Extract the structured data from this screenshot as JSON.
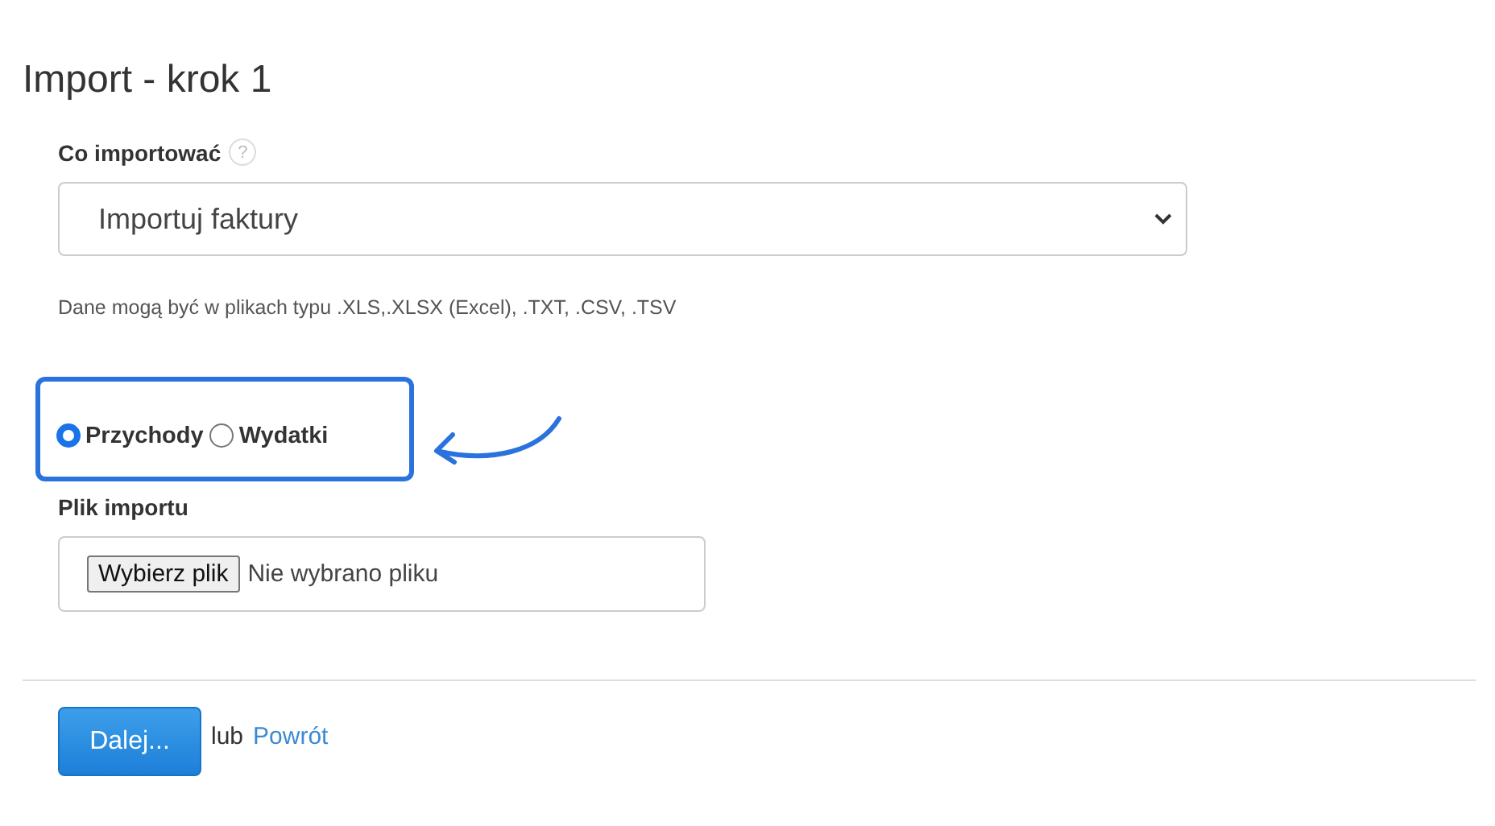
{
  "title": "Import - krok 1",
  "import_type": {
    "label": "Co importować",
    "help": "?",
    "value": "Importuj faktury"
  },
  "hint": "Dane mogą być w plikach typu .XLS,.XLSX (Excel), .TXT, .CSV, .TSV",
  "radios": [
    {
      "label": "Przychody",
      "selected": true
    },
    {
      "label": "Wydatki",
      "selected": false
    }
  ],
  "file": {
    "label": "Plik importu",
    "button": "Wybierz plik",
    "status": "Nie wybrano pliku"
  },
  "footer": {
    "next": "Dalej...",
    "or": "lub",
    "back": "Powrót"
  }
}
